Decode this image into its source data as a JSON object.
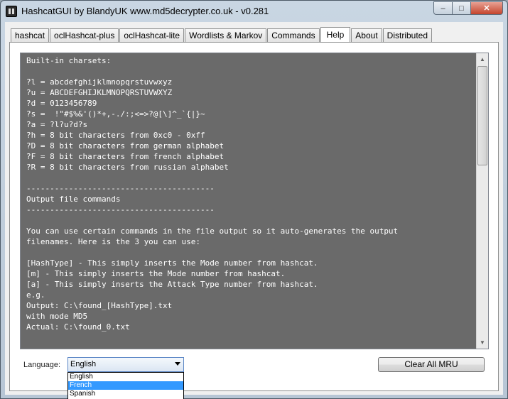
{
  "window": {
    "title": "HashcatGUI by BlandyUK www.md5decrypter.co.uk - v0.281",
    "min_glyph": "–",
    "max_glyph": "□",
    "close_glyph": "✕"
  },
  "tabs": [
    {
      "label": "hashcat",
      "active": false
    },
    {
      "label": "oclHashcat-plus",
      "active": false
    },
    {
      "label": "oclHashcat-lite",
      "active": false
    },
    {
      "label": "Wordlists & Markov",
      "active": false
    },
    {
      "label": "Commands",
      "active": false
    },
    {
      "label": "Help",
      "active": true
    },
    {
      "label": "About",
      "active": false
    },
    {
      "label": "Distributed",
      "active": false
    }
  ],
  "help_text": "Built-in charsets:\n\n?l = abcdefghijklmnopqrstuvwxyz\n?u = ABCDEFGHIJKLMNOPQRSTUVWXYZ\n?d = 0123456789\n?s =  !\"#$%&'()*+,-./:;<=>?@[\\]^_`{|}~\n?a = ?l?u?d?s\n?h = 8 bit characters from 0xc0 - 0xff\n?D = 8 bit characters from german alphabet\n?F = 8 bit characters from french alphabet\n?R = 8 bit characters from russian alphabet\n\n----------------------------------------\nOutput file commands\n----------------------------------------\n\nYou can use certain commands in the file output so it auto-generates the output\nfilenames. Here is the 3 you can use:\n\n[HashType] - This simply inserts the Mode number from hashcat.\n[m] - This simply inserts the Mode number from hashcat.\n[a] - This simply inserts the Attack Type number from hashcat.\ne.g.\nOutput: C:\\found_[HashType].txt\nwith mode MD5\nActual: C:\\found_0.txt",
  "language": {
    "label": "Language:",
    "selected": "English",
    "options": [
      "English",
      "French",
      "Spanish"
    ],
    "highlighted_index": 1
  },
  "clear_mru_label": "Clear All MRU",
  "colors": {
    "help_bg": "#6a6a6a",
    "help_fg": "#ffffff",
    "highlight": "#3399ff"
  }
}
